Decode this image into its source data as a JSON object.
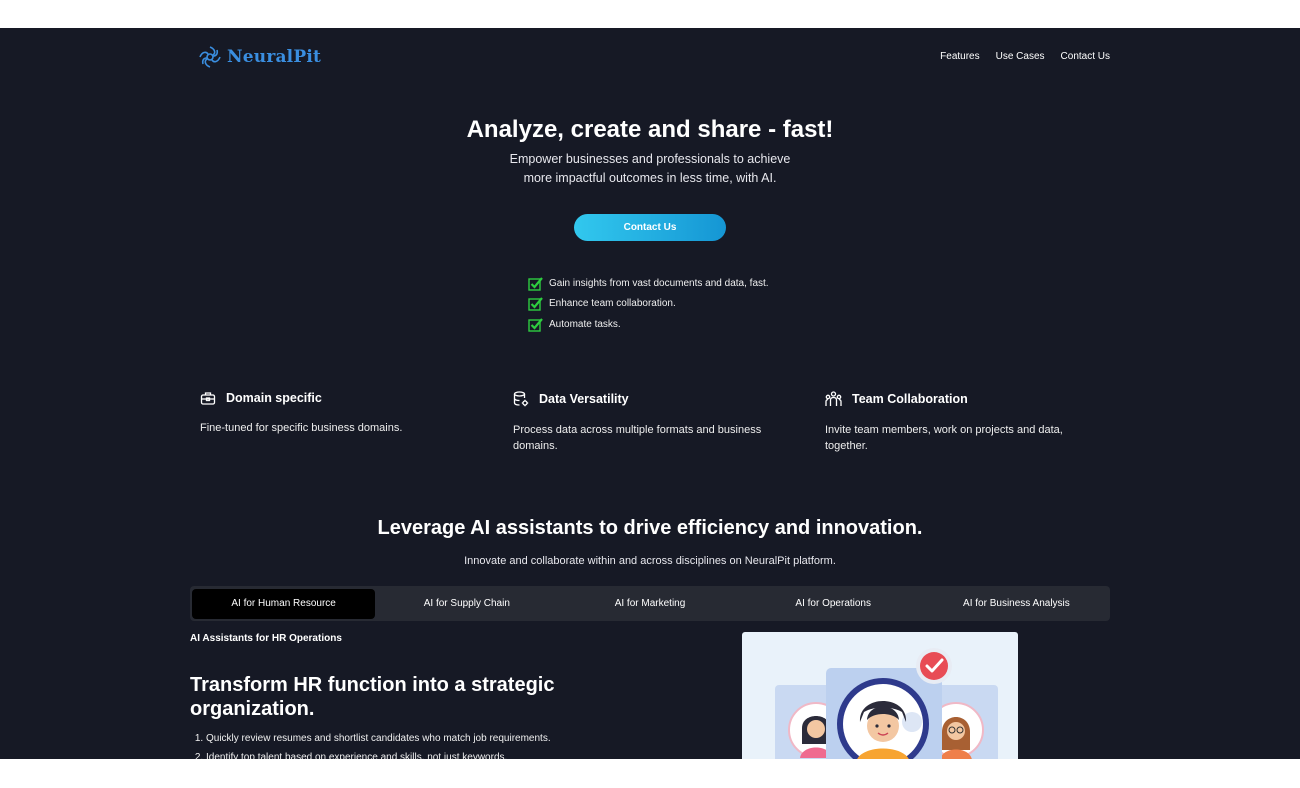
{
  "brand": {
    "name": "NeuralPit",
    "logo_icon": "swirl-logo-icon",
    "color": "#3a8ee0"
  },
  "nav": {
    "links": [
      "Features",
      "Use Cases",
      "Contact Us"
    ]
  },
  "hero": {
    "title": "Analyze, create and share - fast!",
    "subtitle_line1": "Empower businesses and professionals to achieve",
    "subtitle_line2": "more impactful outcomes in less time, with AI.",
    "cta_label": "Contact Us",
    "checks": [
      "Gain insights from vast documents and data, fast.",
      "Enhance team collaboration.",
      "Automate tasks."
    ]
  },
  "features": [
    {
      "icon": "toolbox-icon",
      "title": "Domain specific",
      "text": "Fine-tuned for specific business domains."
    },
    {
      "icon": "database-gear-icon",
      "title": "Data Versatility",
      "text": "Process data across multiple formats and business domains."
    },
    {
      "icon": "team-icon",
      "title": "Team Collaboration",
      "text": "Invite team members, work on projects and data, together."
    }
  ],
  "section": {
    "title": "Leverage AI assistants to drive efficiency and innovation.",
    "subtitle": "Innovate and collaborate within and across disciplines on NeuralPit platform.",
    "tabs": [
      "AI for Human Resource",
      "AI for Supply Chain",
      "AI for Marketing",
      "AI for Operations",
      "AI for Business Analysis"
    ],
    "active_tab": "AI for Human Resource"
  },
  "hr": {
    "label": "AI Assistants for HR Operations",
    "heading": "Transform HR function into a strategic organization.",
    "points": [
      "Quickly review resumes and shortlist candidates who match job requirements.",
      "Identify top talent based on experience and skills, not just keywords."
    ]
  },
  "colors": {
    "page_bg": "#161925",
    "accent": "#1ea8e0",
    "check": "#2ecc40",
    "tab_bar": "#272a33"
  }
}
